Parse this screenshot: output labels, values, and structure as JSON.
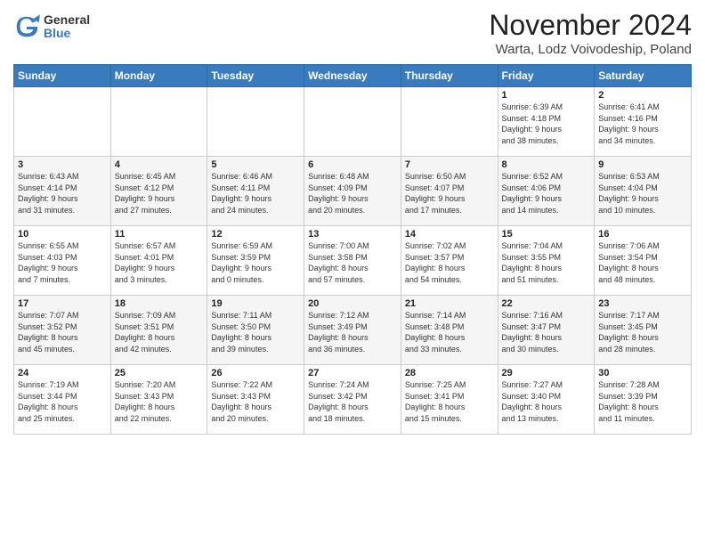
{
  "logo": {
    "general": "General",
    "blue": "Blue"
  },
  "title": "November 2024",
  "location": "Warta, Lodz Voivodeship, Poland",
  "days_of_week": [
    "Sunday",
    "Monday",
    "Tuesday",
    "Wednesday",
    "Thursday",
    "Friday",
    "Saturday"
  ],
  "weeks": [
    [
      {
        "day": "",
        "info": ""
      },
      {
        "day": "",
        "info": ""
      },
      {
        "day": "",
        "info": ""
      },
      {
        "day": "",
        "info": ""
      },
      {
        "day": "",
        "info": ""
      },
      {
        "day": "1",
        "info": "Sunrise: 6:39 AM\nSunset: 4:18 PM\nDaylight: 9 hours\nand 38 minutes."
      },
      {
        "day": "2",
        "info": "Sunrise: 6:41 AM\nSunset: 4:16 PM\nDaylight: 9 hours\nand 34 minutes."
      }
    ],
    [
      {
        "day": "3",
        "info": "Sunrise: 6:43 AM\nSunset: 4:14 PM\nDaylight: 9 hours\nand 31 minutes."
      },
      {
        "day": "4",
        "info": "Sunrise: 6:45 AM\nSunset: 4:12 PM\nDaylight: 9 hours\nand 27 minutes."
      },
      {
        "day": "5",
        "info": "Sunrise: 6:46 AM\nSunset: 4:11 PM\nDaylight: 9 hours\nand 24 minutes."
      },
      {
        "day": "6",
        "info": "Sunrise: 6:48 AM\nSunset: 4:09 PM\nDaylight: 9 hours\nand 20 minutes."
      },
      {
        "day": "7",
        "info": "Sunrise: 6:50 AM\nSunset: 4:07 PM\nDaylight: 9 hours\nand 17 minutes."
      },
      {
        "day": "8",
        "info": "Sunrise: 6:52 AM\nSunset: 4:06 PM\nDaylight: 9 hours\nand 14 minutes."
      },
      {
        "day": "9",
        "info": "Sunrise: 6:53 AM\nSunset: 4:04 PM\nDaylight: 9 hours\nand 10 minutes."
      }
    ],
    [
      {
        "day": "10",
        "info": "Sunrise: 6:55 AM\nSunset: 4:03 PM\nDaylight: 9 hours\nand 7 minutes."
      },
      {
        "day": "11",
        "info": "Sunrise: 6:57 AM\nSunset: 4:01 PM\nDaylight: 9 hours\nand 3 minutes."
      },
      {
        "day": "12",
        "info": "Sunrise: 6:59 AM\nSunset: 3:59 PM\nDaylight: 9 hours\nand 0 minutes."
      },
      {
        "day": "13",
        "info": "Sunrise: 7:00 AM\nSunset: 3:58 PM\nDaylight: 8 hours\nand 57 minutes."
      },
      {
        "day": "14",
        "info": "Sunrise: 7:02 AM\nSunset: 3:57 PM\nDaylight: 8 hours\nand 54 minutes."
      },
      {
        "day": "15",
        "info": "Sunrise: 7:04 AM\nSunset: 3:55 PM\nDaylight: 8 hours\nand 51 minutes."
      },
      {
        "day": "16",
        "info": "Sunrise: 7:06 AM\nSunset: 3:54 PM\nDaylight: 8 hours\nand 48 minutes."
      }
    ],
    [
      {
        "day": "17",
        "info": "Sunrise: 7:07 AM\nSunset: 3:52 PM\nDaylight: 8 hours\nand 45 minutes."
      },
      {
        "day": "18",
        "info": "Sunrise: 7:09 AM\nSunset: 3:51 PM\nDaylight: 8 hours\nand 42 minutes."
      },
      {
        "day": "19",
        "info": "Sunrise: 7:11 AM\nSunset: 3:50 PM\nDaylight: 8 hours\nand 39 minutes."
      },
      {
        "day": "20",
        "info": "Sunrise: 7:12 AM\nSunset: 3:49 PM\nDaylight: 8 hours\nand 36 minutes."
      },
      {
        "day": "21",
        "info": "Sunrise: 7:14 AM\nSunset: 3:48 PM\nDaylight: 8 hours\nand 33 minutes."
      },
      {
        "day": "22",
        "info": "Sunrise: 7:16 AM\nSunset: 3:47 PM\nDaylight: 8 hours\nand 30 minutes."
      },
      {
        "day": "23",
        "info": "Sunrise: 7:17 AM\nSunset: 3:45 PM\nDaylight: 8 hours\nand 28 minutes."
      }
    ],
    [
      {
        "day": "24",
        "info": "Sunrise: 7:19 AM\nSunset: 3:44 PM\nDaylight: 8 hours\nand 25 minutes."
      },
      {
        "day": "25",
        "info": "Sunrise: 7:20 AM\nSunset: 3:43 PM\nDaylight: 8 hours\nand 22 minutes."
      },
      {
        "day": "26",
        "info": "Sunrise: 7:22 AM\nSunset: 3:43 PM\nDaylight: 8 hours\nand 20 minutes."
      },
      {
        "day": "27",
        "info": "Sunrise: 7:24 AM\nSunset: 3:42 PM\nDaylight: 8 hours\nand 18 minutes."
      },
      {
        "day": "28",
        "info": "Sunrise: 7:25 AM\nSunset: 3:41 PM\nDaylight: 8 hours\nand 15 minutes."
      },
      {
        "day": "29",
        "info": "Sunrise: 7:27 AM\nSunset: 3:40 PM\nDaylight: 8 hours\nand 13 minutes."
      },
      {
        "day": "30",
        "info": "Sunrise: 7:28 AM\nSunset: 3:39 PM\nDaylight: 8 hours\nand 11 minutes."
      }
    ]
  ]
}
